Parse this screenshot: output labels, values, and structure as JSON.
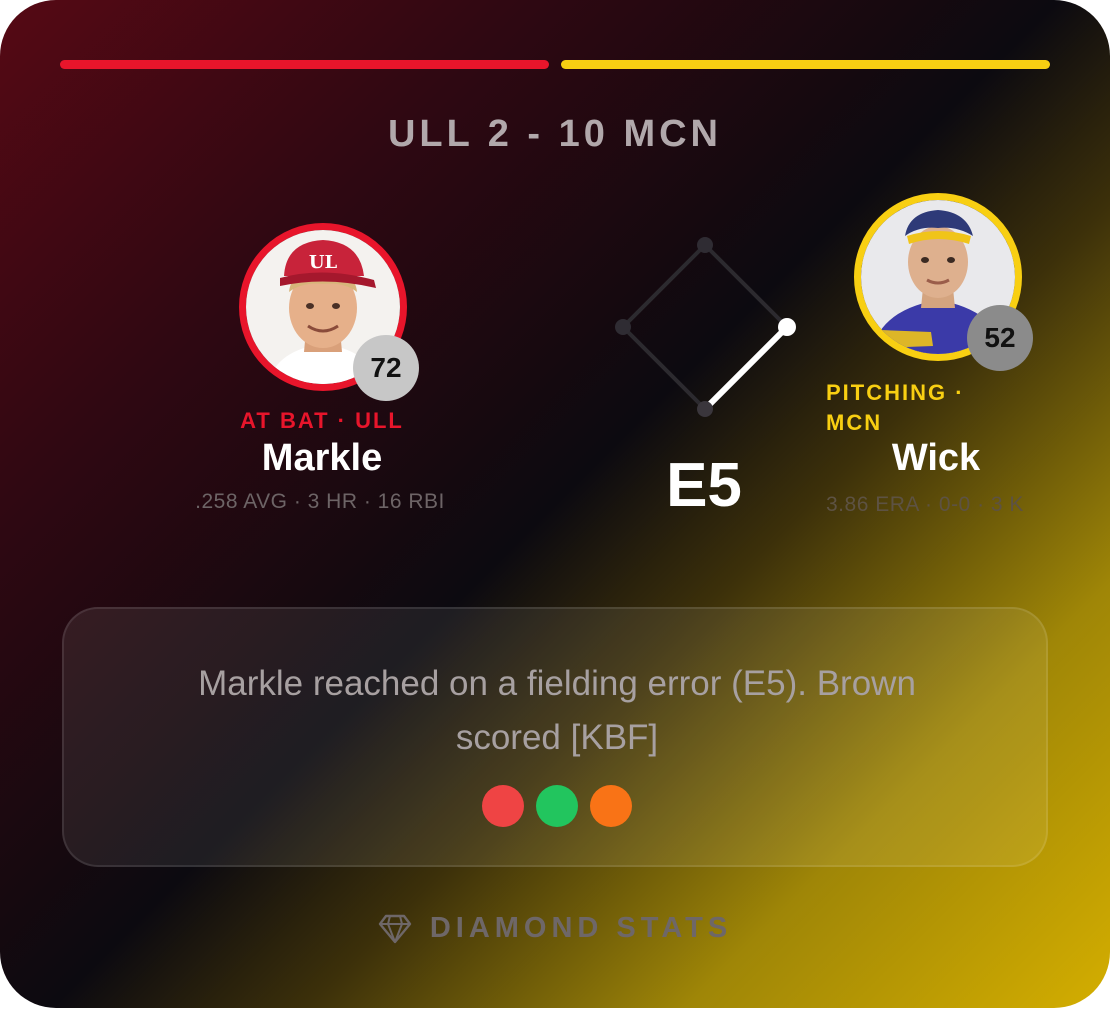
{
  "score": "ULL 2 - 10 MCN",
  "colors": {
    "home_accent": "#e8152b",
    "away_accent": "#f8cf12"
  },
  "batter": {
    "role": "AT BAT · ULL",
    "name": "Markle",
    "number": "72",
    "stats": ".258 AVG · 3 HR · 16 RBI"
  },
  "pitcher": {
    "role": "PITCHING · MCN",
    "name": "Wick",
    "number": "52",
    "stats": "3.86 ERA · 0-0 · 3 K"
  },
  "play": {
    "result": "E5",
    "description": "Markle reached on a fielding error (E5). Brown scored [KBF]",
    "dots": [
      {
        "name": "red-dot",
        "color": "#ef4444"
      },
      {
        "name": "green-dot",
        "color": "#22c55e"
      },
      {
        "name": "orange-dot",
        "color": "#f97316"
      }
    ]
  },
  "bases": {
    "first_occupied": true,
    "second_occupied": false,
    "third_occupied": false,
    "path": "home-to-first"
  },
  "footer": {
    "icon": "diamond-icon",
    "label": "DIAMOND STATS"
  }
}
